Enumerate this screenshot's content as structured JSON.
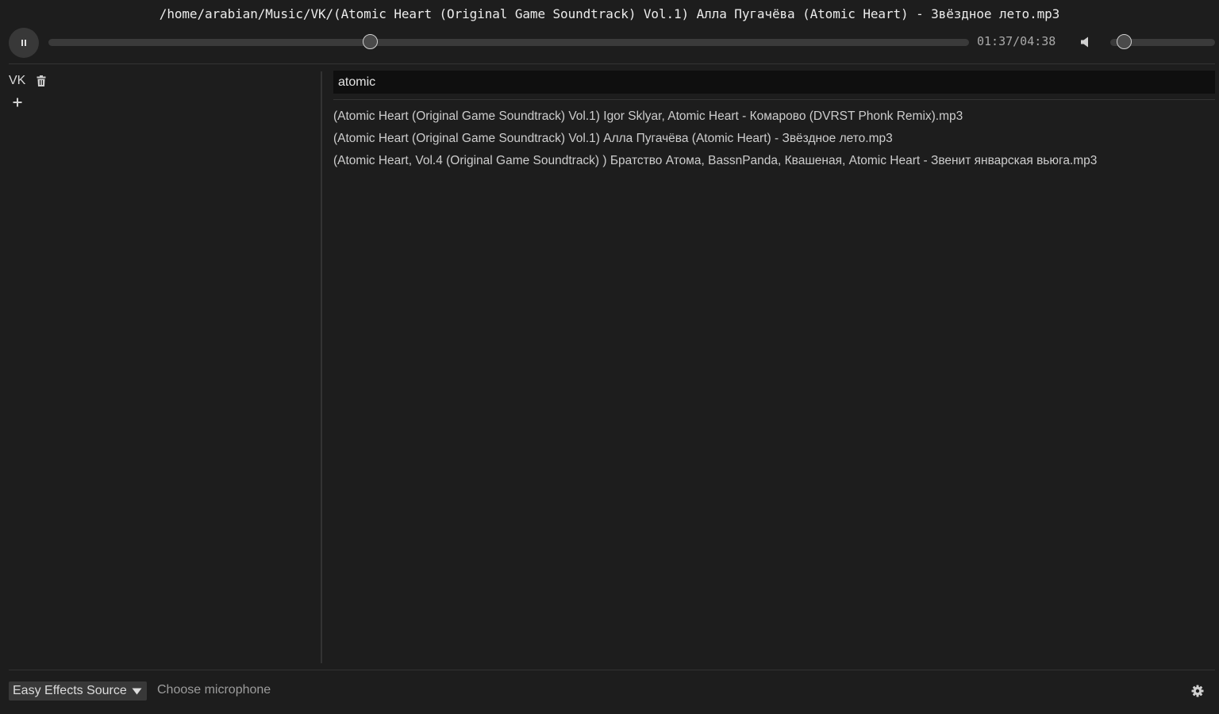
{
  "header": {
    "now_playing": "/home/arabian/Music/VK/(Atomic Heart (Original Game Soundtrack) Vol.1) Алла Пугачёва (Atomic Heart) - Звёздное лето.mp3",
    "time": "01:37/04:38",
    "seek_fraction": 0.3501,
    "volume_fraction": 0.14
  },
  "sidebar": {
    "playlists": [
      {
        "label": "VK"
      }
    ]
  },
  "search": {
    "value": "atomic",
    "placeholder": ""
  },
  "results": [
    "(Atomic Heart (Original Game Soundtrack) Vol.1) Igor Sklyar, Atomic Heart - Комарово (DVRST Phonk Remix).mp3",
    "(Atomic Heart (Original Game Soundtrack) Vol.1) Алла Пугачёва (Atomic Heart) - Звёздное лето.mp3",
    "(Atomic Heart, Vol.4 (Original Game Soundtrack) ) Братство Атома, BassnPanda, Квашеная, Atomic Heart - Звенит январская вьюга.mp3"
  ],
  "footer": {
    "source_label": "Easy Effects Source",
    "mic_hint": "Choose microphone"
  },
  "icons": {
    "pause": "pause-icon",
    "volume": "volume-icon",
    "trash": "trash-icon",
    "add": "add-icon",
    "dropdown": "dropdown-icon",
    "settings": "gear-icon"
  }
}
